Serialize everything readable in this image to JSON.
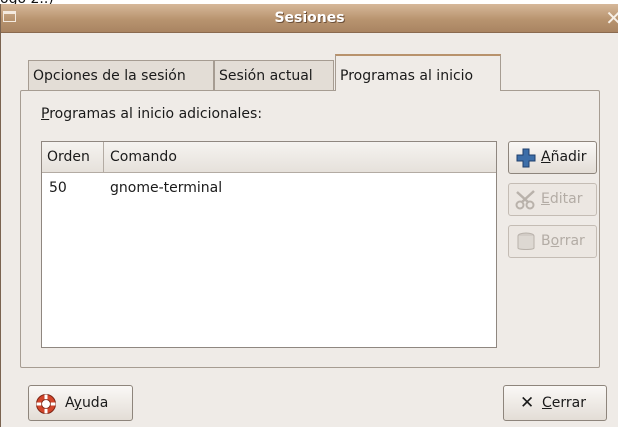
{
  "caption": {
    "text": "ogo 2..)"
  },
  "window": {
    "title": "Sesiones"
  },
  "tabs": [
    {
      "label": "Opciones de la sesión"
    },
    {
      "label": "Sesión actual"
    },
    {
      "label": "Programas al inicio"
    }
  ],
  "panel": {
    "label_first": "P",
    "label_rest": "rogramas al inicio adicionales:"
  },
  "list": {
    "columns": [
      "Orden",
      "Comando"
    ],
    "rows": [
      {
        "order": "50",
        "command": "gnome-terminal"
      }
    ]
  },
  "buttons": {
    "add": {
      "pre": "",
      "u": "A",
      "post": "ñadir"
    },
    "edit": {
      "pre": "",
      "u": "E",
      "post": "ditar"
    },
    "remove": {
      "pre": "B",
      "u": "o",
      "post": "rrar"
    },
    "help": {
      "pre": "A",
      "u": "y",
      "post": "uda"
    },
    "close": {
      "pre": "",
      "u": "C",
      "post": "errar"
    }
  },
  "icons": {
    "add": "plus-icon",
    "edit": "scissors-icon",
    "remove": "trash-icon",
    "help": "lifebuoy-icon",
    "close": "x-icon"
  },
  "colors": {
    "titlebar": "#b8946f",
    "window_bg": "#efebe7",
    "add_icon": "#3d6ea8",
    "help_icon": "#d2452b"
  }
}
